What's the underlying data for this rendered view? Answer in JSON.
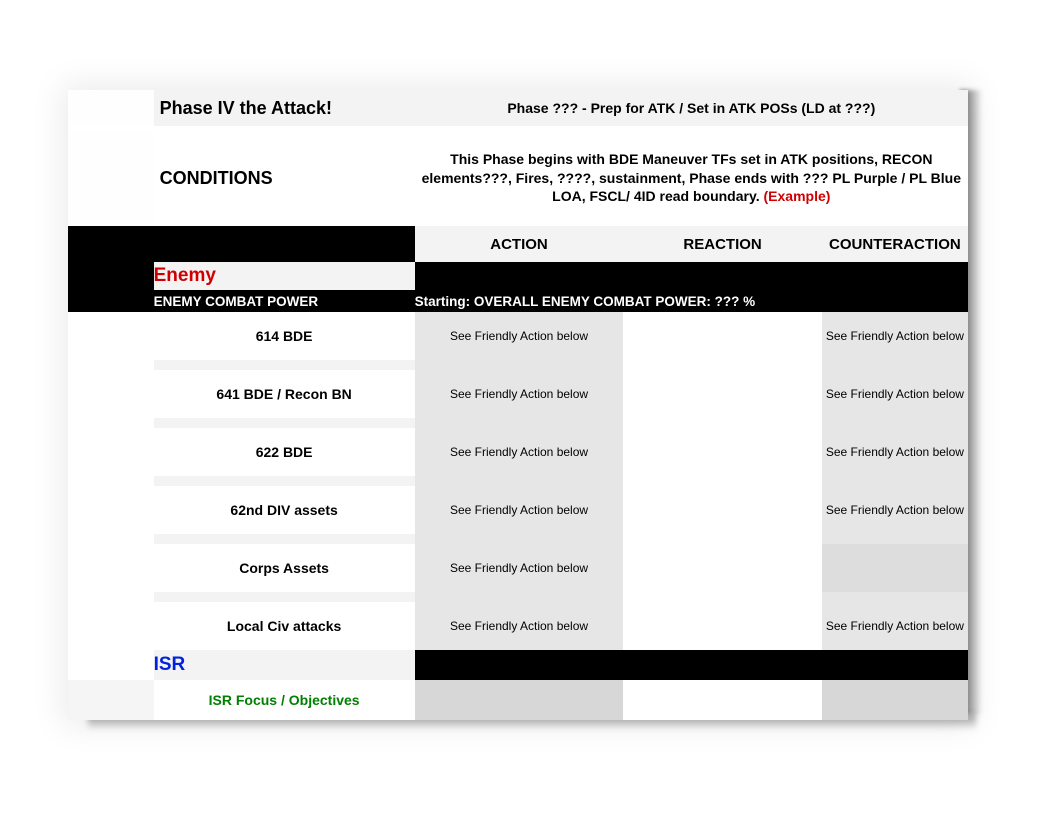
{
  "title": {
    "left": "Phase IV the Attack!",
    "right": "Phase ???  - Prep for ATK / Set in ATK POSs (LD at ???)"
  },
  "conditions": {
    "label": "CONDITIONS",
    "text": "This Phase begins with BDE Maneuver TFs set in ATK positions,  RECON elements???, Fires, ????, sustainment,  Phase ends with ??? PL Purple / PL Blue LOA, FSCL/ 4ID read boundary.",
    "example": "(Example)"
  },
  "headers": {
    "action": "ACTION",
    "reaction": "REACTION",
    "counteraction": "COUNTERACTION"
  },
  "enemy": {
    "label": "Enemy",
    "power_label": "ENEMY COMBAT POWER",
    "power_right": "Starting:  OVERALL ENEMY COMBAT POWER:  ??? %"
  },
  "enemy_rows": [
    {
      "unit": "614 BDE",
      "action": "See Friendly Action below",
      "reaction": "",
      "counter": "See Friendly Action below"
    },
    {
      "unit": "641 BDE / Recon BN",
      "action": "See Friendly Action below",
      "reaction": "",
      "counter": "See Friendly Action below"
    },
    {
      "unit": "622 BDE",
      "action": "See Friendly Action below",
      "reaction": "",
      "counter": "See Friendly Action below"
    },
    {
      "unit": "62nd DIV assets",
      "action": "See Friendly Action below",
      "reaction": "",
      "counter": "See Friendly Action below"
    },
    {
      "unit": "Corps Assets",
      "action": "See Friendly Action below",
      "reaction": "",
      "counter": ""
    },
    {
      "unit": "Local Civ attacks",
      "action": "See Friendly Action below",
      "reaction": "",
      "counter": "See Friendly Action below"
    }
  ],
  "isr": {
    "label": "ISR",
    "focus": "ISR Focus / Objectives"
  }
}
